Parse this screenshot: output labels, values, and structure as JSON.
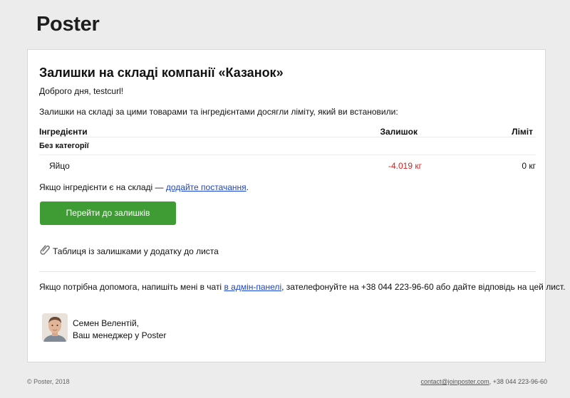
{
  "header": {
    "logo_text": "Poster"
  },
  "email": {
    "title": "Залишки на складі компанії «Казанок»",
    "greeting": "Доброго дня, testcurl!",
    "intro": "Залишки на складі за цими товарами та інгредієнтами досягли ліміту, який ви встановили:",
    "table": {
      "headers": {
        "ingredients": "Інгредієнти",
        "stock": "Залишок",
        "limit": "Ліміт"
      },
      "category": "Без категорії",
      "rows": [
        {
          "name": "Яйцо",
          "stock": "-4.019 кг",
          "limit": "0 кг"
        }
      ]
    },
    "supply_text_before": "Якщо інгредієнти є на складі — ",
    "supply_link": "додайте постачання",
    "supply_text_after": ".",
    "button_label": "Перейти до залишків",
    "attachment_icon": "paperclip-icon",
    "attachment_text": "Таблиця із залишками у додатку до листа",
    "help_text_before": "Якщо потрібна допомога, напишіть мені в чаті ",
    "help_link": "в адмін-панелі",
    "help_text_after": ", зателефонуйте на +38 044 223-96-60 або дайте відповідь на цей лист.",
    "manager": {
      "name": "Семен Велентій,",
      "role": "Ваш менеджер у Poster"
    }
  },
  "footer": {
    "copyright": "© Poster, 2018",
    "contact_email": "contact@joinposter.com",
    "contact_phone": ", +38 044 223-96-60"
  },
  "colors": {
    "button": "#3f9c35",
    "link": "#1a44d6",
    "negative": "#e02020",
    "background": "#ececec"
  }
}
